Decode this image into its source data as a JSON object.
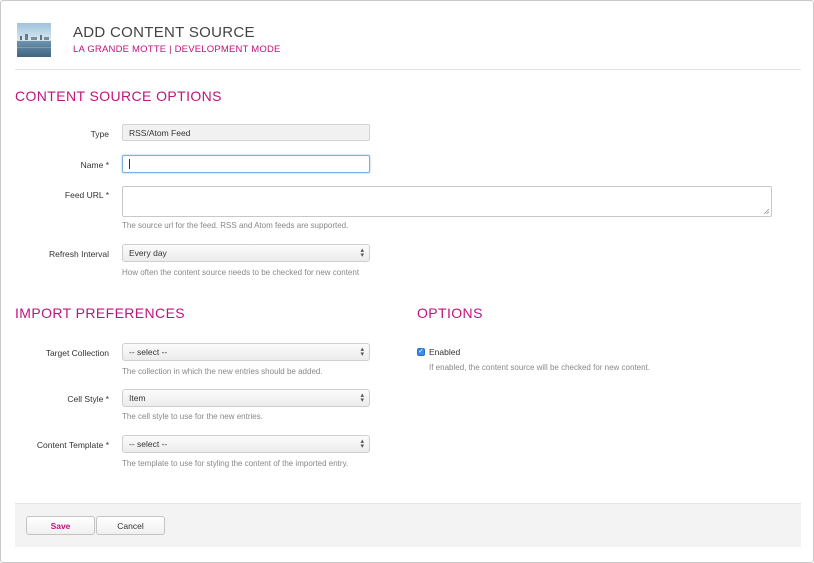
{
  "header": {
    "title": "ADD CONTENT SOURCE",
    "subtitle": "LA GRANDE MOTTE | DEVELOPMENT MODE"
  },
  "content_source_options": {
    "title": "CONTENT SOURCE OPTIONS",
    "type": {
      "label": "Type",
      "value": "RSS/Atom Feed"
    },
    "name": {
      "label": "Name *",
      "value": ""
    },
    "feed_url": {
      "label": "Feed URL *",
      "value": "",
      "help": "The source url for the feed. RSS and Atom feeds are supported."
    },
    "refresh_interval": {
      "label": "Refresh Interval",
      "selected": "Every day",
      "help": "How often the content source needs to be checked for new content"
    }
  },
  "import_preferences": {
    "title": "IMPORT PREFERENCES",
    "target_collection": {
      "label": "Target Collection",
      "selected": "-- select --",
      "help": "The collection in which the new entries should be added."
    },
    "cell_style": {
      "label": "Cell Style *",
      "selected": "Item",
      "help": "The cell style to use for the new entries."
    },
    "content_template": {
      "label": "Content Template *",
      "selected": "-- select --",
      "help": "The template to use for styling the content of the imported entry."
    }
  },
  "options": {
    "title": "OPTIONS",
    "enabled": {
      "label": "Enabled",
      "checked": true,
      "help": "If enabled, the content source will be checked for new content."
    }
  },
  "footer": {
    "save_label": "Save",
    "cancel_label": "Cancel"
  },
  "colors": {
    "accent": "#c0137c",
    "checkbox": "#3b8ee8"
  }
}
